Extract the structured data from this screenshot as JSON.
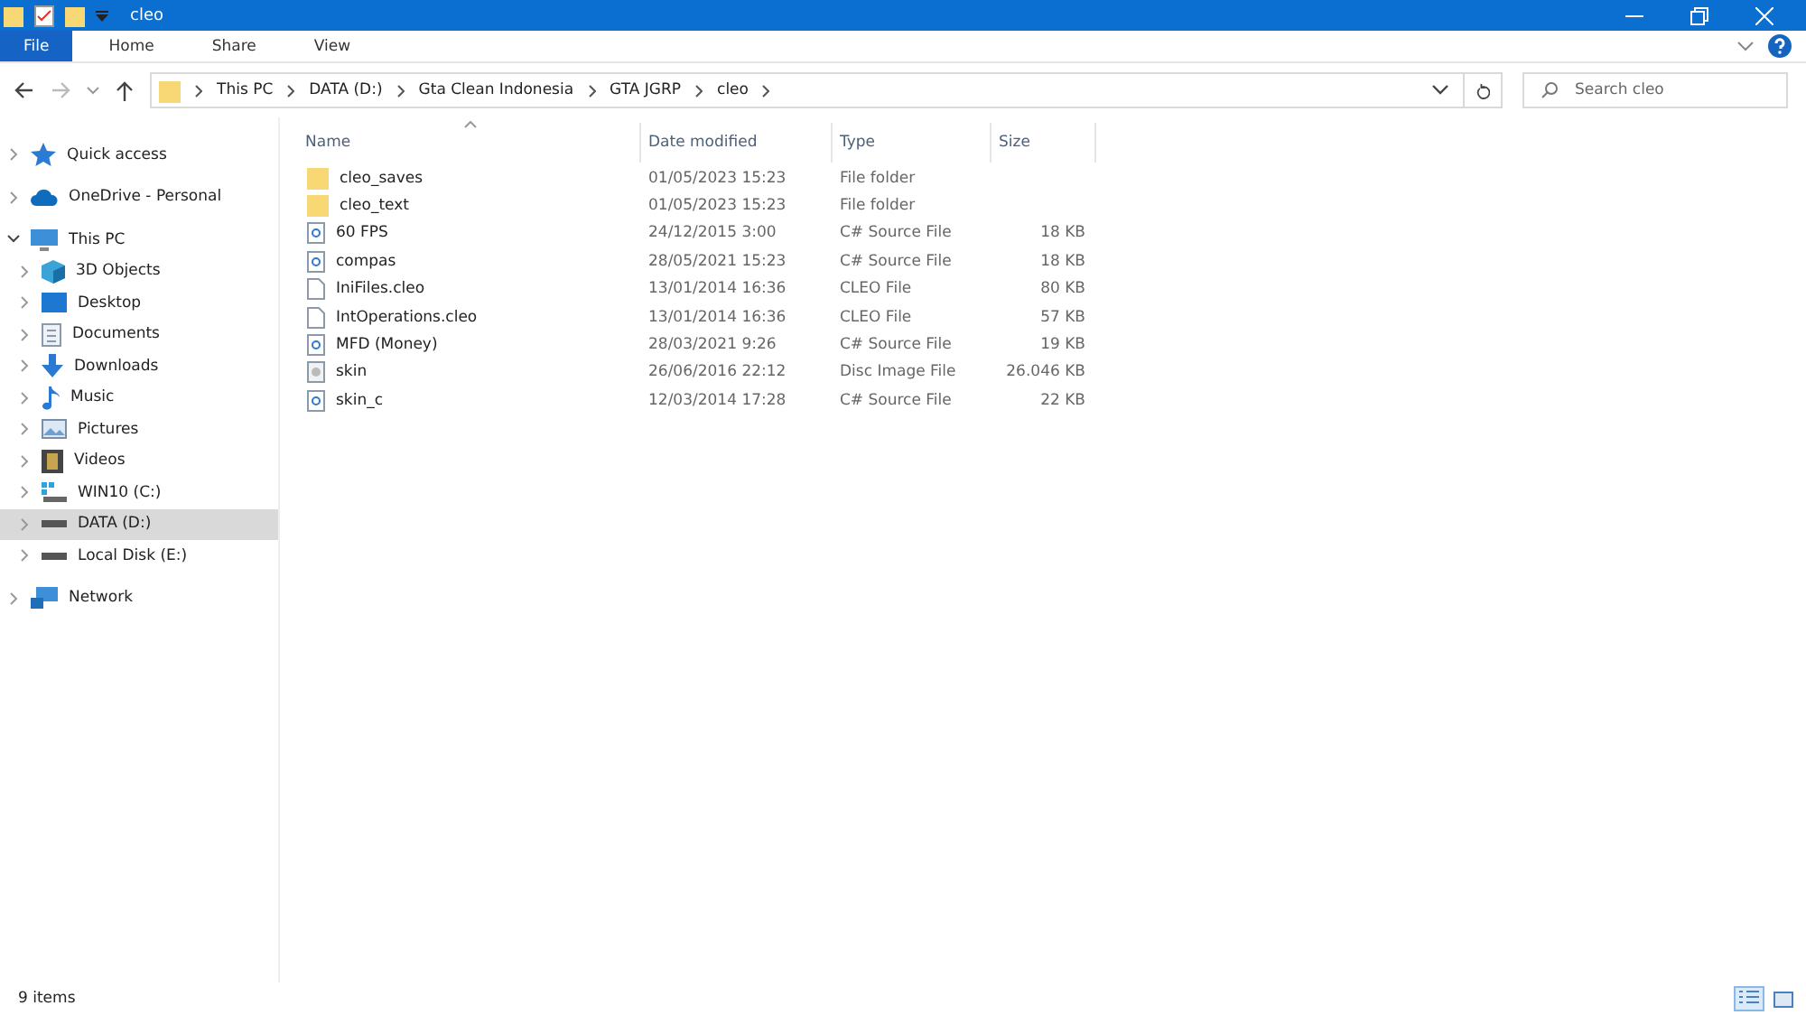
{
  "window": {
    "title": "cleo"
  },
  "ribbon_tabs": [
    {
      "label": "File",
      "selected": true
    },
    {
      "label": "Home",
      "selected": false
    },
    {
      "label": "Share",
      "selected": false
    },
    {
      "label": "View",
      "selected": false
    }
  ],
  "breadcrumb": [
    "This PC",
    "DATA (D:)",
    "Gta Clean Indonesia",
    "GTA JGRP",
    "cleo"
  ],
  "search": {
    "placeholder": "Search cleo"
  },
  "sidebar": {
    "items": [
      {
        "label": "Quick access",
        "kind": "star",
        "expanded": false,
        "selected": false
      },
      {
        "label": "OneDrive - Personal",
        "kind": "cloud",
        "expanded": false,
        "selected": false
      },
      {
        "label": "This PC",
        "kind": "pc",
        "expanded": true,
        "selected": false,
        "children": [
          {
            "label": "3D Objects",
            "kind": "cube",
            "expanded": false,
            "selected": false
          },
          {
            "label": "Desktop",
            "kind": "desktop",
            "expanded": false,
            "selected": false
          },
          {
            "label": "Documents",
            "kind": "document",
            "expanded": false,
            "selected": false
          },
          {
            "label": "Downloads",
            "kind": "download",
            "expanded": false,
            "selected": false
          },
          {
            "label": "Music",
            "kind": "music",
            "expanded": false,
            "selected": false
          },
          {
            "label": "Pictures",
            "kind": "pictures",
            "expanded": false,
            "selected": false
          },
          {
            "label": "Videos",
            "kind": "videos",
            "expanded": false,
            "selected": false
          },
          {
            "label": "WIN10 (C:)",
            "kind": "sysdrive",
            "expanded": false,
            "selected": false
          },
          {
            "label": "DATA (D:)",
            "kind": "drive",
            "expanded": false,
            "selected": true
          },
          {
            "label": "Local Disk (E:)",
            "kind": "drive",
            "expanded": false,
            "selected": false
          }
        ]
      },
      {
        "label": "Network",
        "kind": "network",
        "expanded": false,
        "selected": false
      }
    ]
  },
  "table": {
    "columns": [
      "Name",
      "Date modified",
      "Type",
      "Size"
    ],
    "rows": [
      {
        "name": "cleo_saves",
        "kind": "folder",
        "date": "01/05/2023 15:23",
        "type": "File folder",
        "size": ""
      },
      {
        "name": "cleo_text",
        "kind": "folder",
        "date": "01/05/2023 15:23",
        "type": "File folder",
        "size": ""
      },
      {
        "name": "60 FPS",
        "kind": "source",
        "date": "24/12/2015 3:00",
        "type": "C# Source File",
        "size": "18 KB"
      },
      {
        "name": "compas",
        "kind": "source",
        "date": "28/05/2021 15:23",
        "type": "C# Source File",
        "size": "18 KB"
      },
      {
        "name": "IniFiles.cleo",
        "kind": "file",
        "date": "13/01/2014 16:36",
        "type": "CLEO File",
        "size": "80 KB"
      },
      {
        "name": "IntOperations.cleo",
        "kind": "file",
        "date": "13/01/2014 16:36",
        "type": "CLEO File",
        "size": "57 KB"
      },
      {
        "name": "MFD (Money)",
        "kind": "source",
        "date": "28/03/2021 9:26",
        "type": "C# Source File",
        "size": "19 KB"
      },
      {
        "name": "skin",
        "kind": "disc",
        "date": "26/06/2016 22:12",
        "type": "Disc Image File",
        "size": "26.046 KB"
      },
      {
        "name": "skin_c",
        "kind": "source",
        "date": "12/03/2014 17:28",
        "type": "C# Source File",
        "size": "22 KB"
      }
    ]
  },
  "status_bar": {
    "count": "9 items"
  }
}
